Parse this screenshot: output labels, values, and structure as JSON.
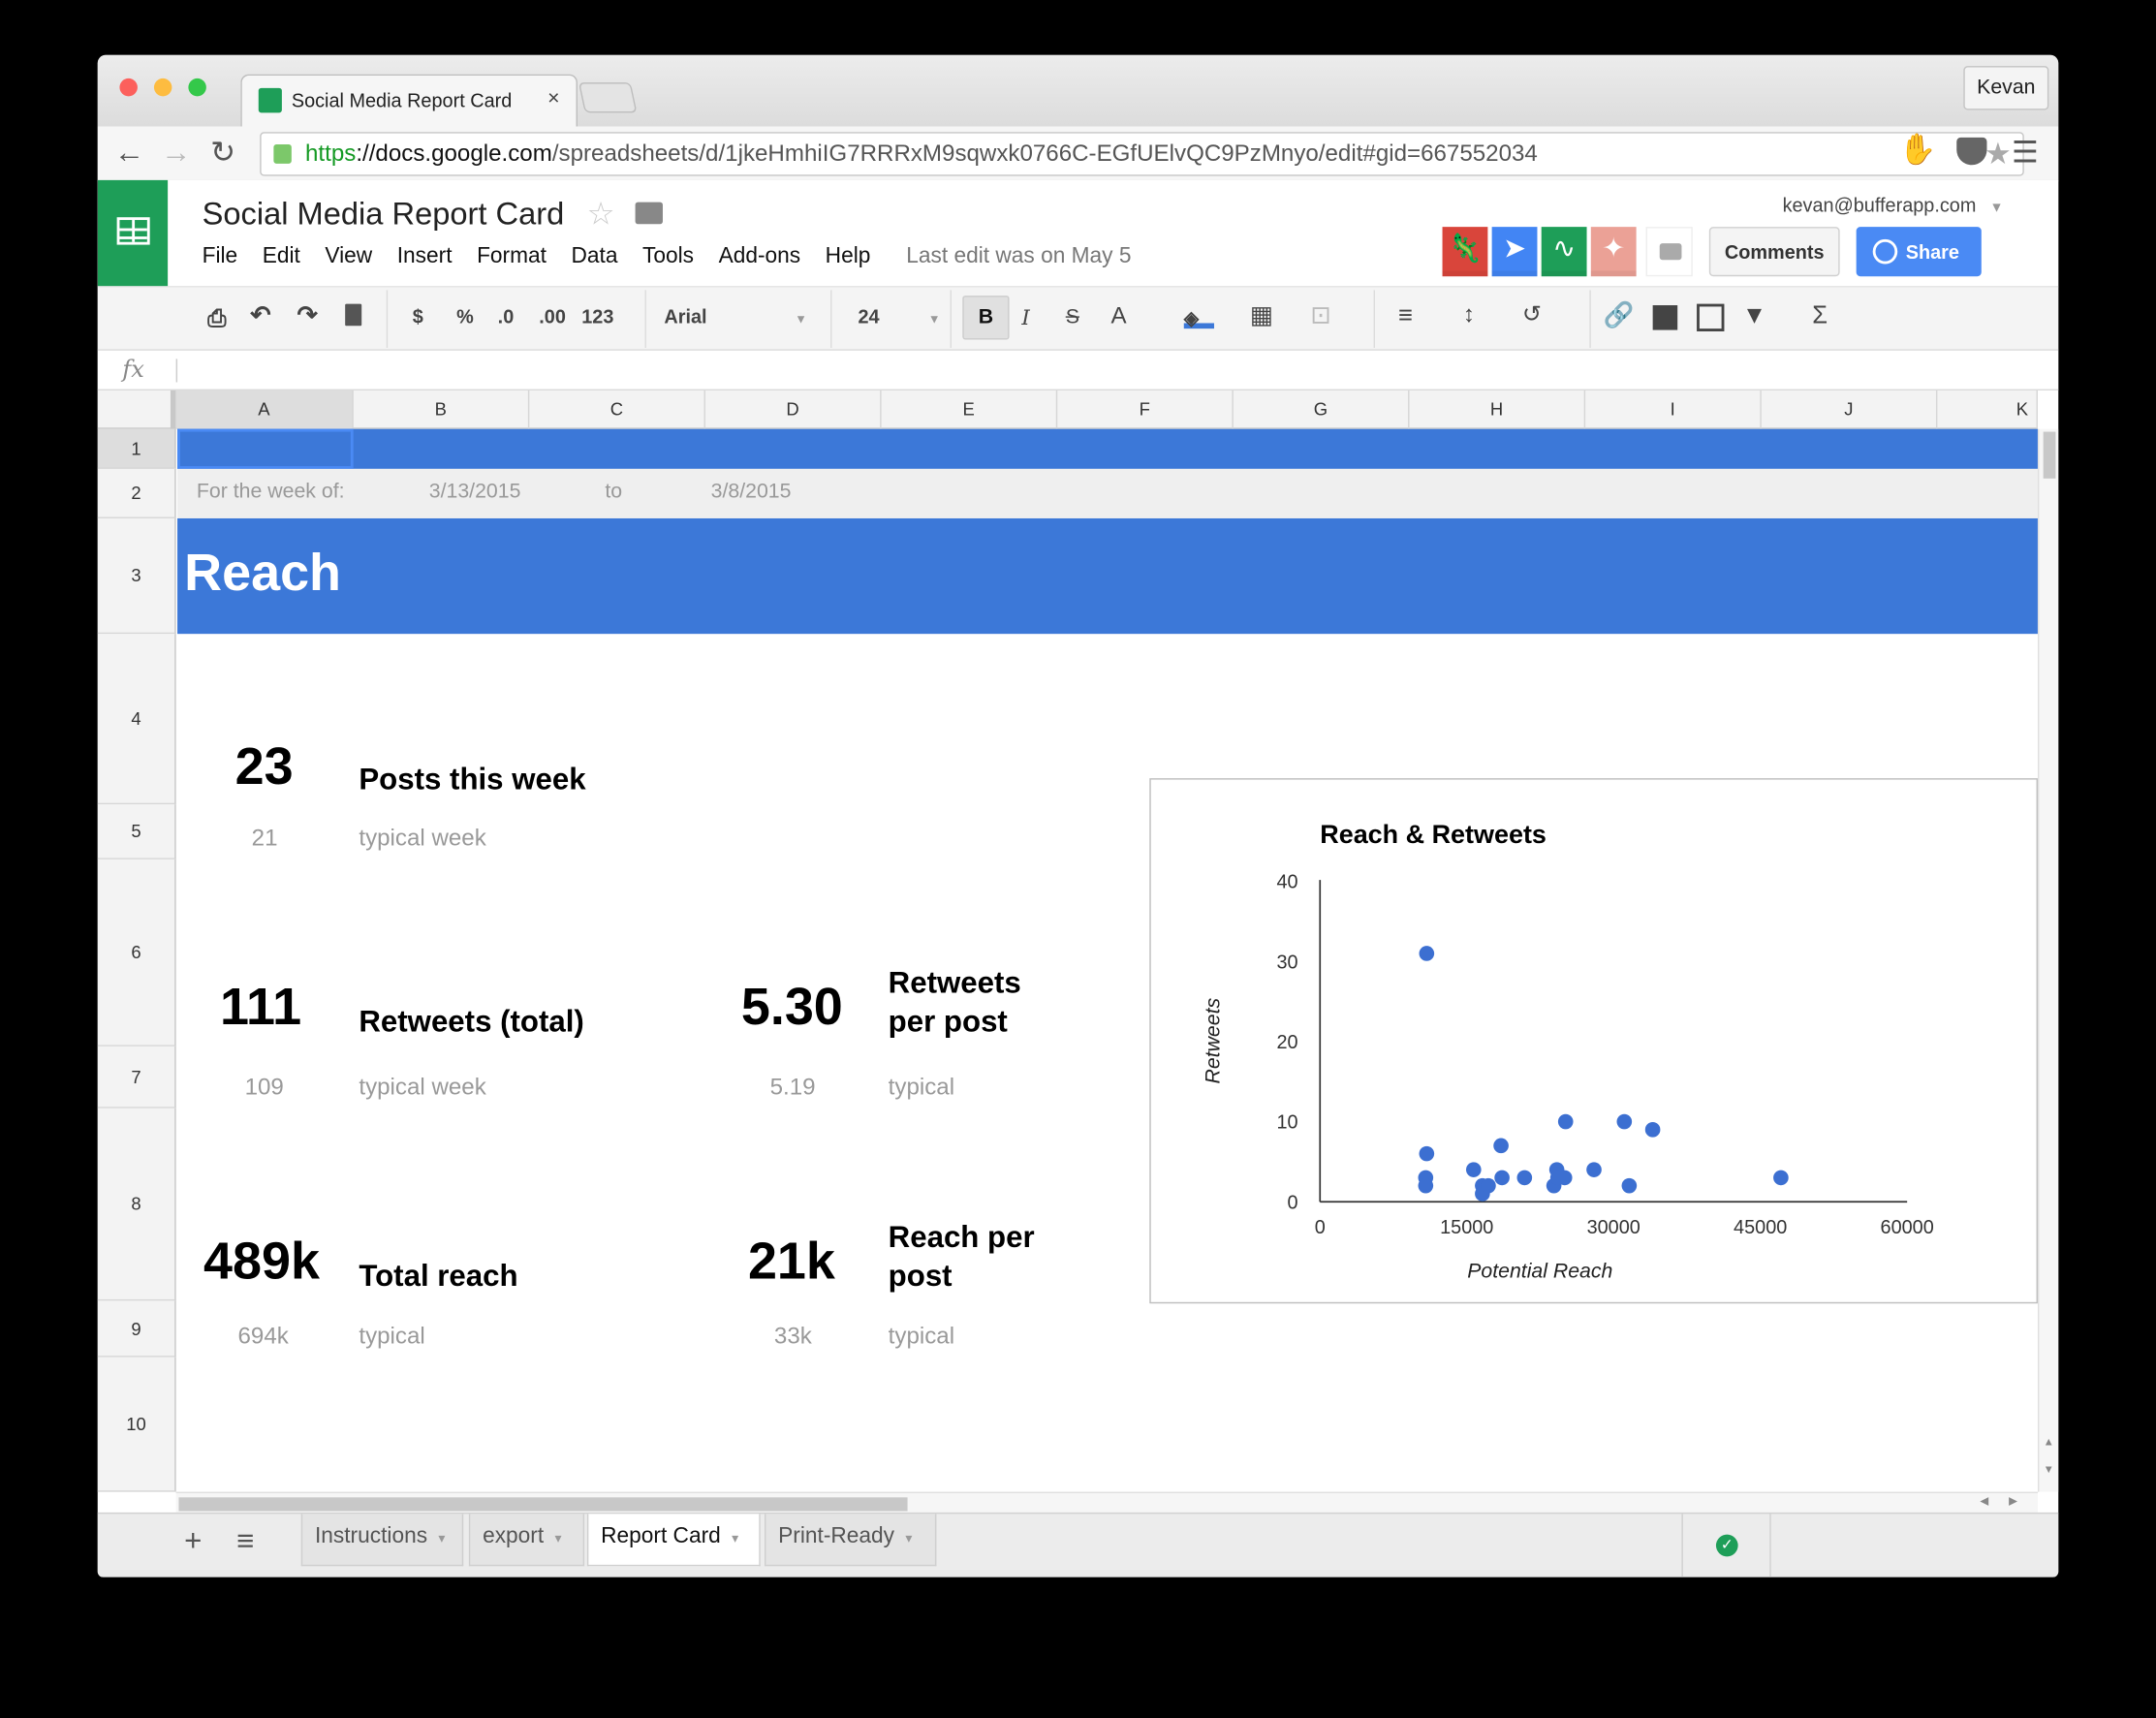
{
  "browser": {
    "tab_title": "Social Media Report Card",
    "tab_close": "×",
    "profile": "Kevan",
    "url_scheme": "https",
    "url_host": "://docs.google.com",
    "url_path": "/spreadsheets/d/1jkeHmhiIG7RRRxM9sqwxk0766C-EGfUElvQC9PzMnyo/edit#gid=667552034",
    "icons": [
      "back-icon",
      "forward-icon",
      "reload-icon",
      "lock-icon",
      "bookmark-star-icon",
      "adblock-icon",
      "pocket-icon",
      "menu-icon"
    ]
  },
  "app": {
    "doc_title": "Social Media Report Card",
    "menu": [
      "File",
      "Edit",
      "View",
      "Insert",
      "Format",
      "Data",
      "Tools",
      "Add-ons",
      "Help"
    ],
    "last_edit": "Last edit was on May 5",
    "user_email": "kevan@bufferapp.com",
    "comments_label": "Comments",
    "share_label": "Share",
    "brand_color": "#1e9e58",
    "share_color": "#4a8af4"
  },
  "toolbar": {
    "currency": "$",
    "percent": "%",
    "dec_decrease": ".0",
    "dec_increase": ".00",
    "more_formats": "123",
    "font": "Arial",
    "font_size": "24",
    "bold": "B",
    "italic": "I",
    "strike": "S",
    "text_color": "A"
  },
  "formula": {
    "fx": "fx",
    "value": ""
  },
  "columns": [
    "A",
    "B",
    "C",
    "D",
    "E",
    "F",
    "G",
    "H",
    "I",
    "J",
    "K"
  ],
  "rows": [
    "1",
    "2",
    "3",
    "4",
    "5",
    "6",
    "7",
    "8",
    "9",
    "10"
  ],
  "sheet": {
    "week_label": "For the week of:",
    "date_from": "3/13/2015",
    "to": "to",
    "date_to": "3/8/2015",
    "section_title": "Reach",
    "header_color": "#3c78d8",
    "metrics": {
      "posts": {
        "value": "23",
        "label": "Posts this week",
        "typical_value": "21",
        "typical_label": "typical week"
      },
      "retweets": {
        "value": "111",
        "label": "Retweets (total)",
        "typical_value": "109",
        "typical_label": "typical week"
      },
      "rt_per_post": {
        "value": "5.30",
        "label_line1": "Retweets",
        "label_line2": "per post",
        "typical_value": "5.19",
        "typical_label": "typical"
      },
      "reach": {
        "value": "489k",
        "label": "Total reach",
        "typical_value": "694k",
        "typical_label": "typical"
      },
      "reach_per_post": {
        "value": "21k",
        "label_line1": "Reach per",
        "label_line2": "post",
        "typical_value": "33k",
        "typical_label": "typical"
      }
    }
  },
  "chart_data": {
    "type": "scatter",
    "title": "Reach & Retweets",
    "xlabel": "Potential Reach",
    "ylabel": "Retweets",
    "xlim": [
      0,
      60000
    ],
    "ylim": [
      0,
      40
    ],
    "xticks": [
      "0",
      "15000",
      "30000",
      "45000",
      "60000"
    ],
    "yticks": [
      "0",
      "10",
      "20",
      "30",
      "40"
    ],
    "grid": false,
    "color": "#3c6fd1",
    "points": [
      {
        "x": 10900,
        "y": 31
      },
      {
        "x": 10900,
        "y": 6
      },
      {
        "x": 10800,
        "y": 3
      },
      {
        "x": 10800,
        "y": 2
      },
      {
        "x": 15700,
        "y": 4
      },
      {
        "x": 16600,
        "y": 2
      },
      {
        "x": 16600,
        "y": 1
      },
      {
        "x": 17200,
        "y": 2
      },
      {
        "x": 18500,
        "y": 7
      },
      {
        "x": 18600,
        "y": 3
      },
      {
        "x": 20900,
        "y": 3
      },
      {
        "x": 23900,
        "y": 2
      },
      {
        "x": 24200,
        "y": 4
      },
      {
        "x": 24300,
        "y": 3
      },
      {
        "x": 25000,
        "y": 3
      },
      {
        "x": 25100,
        "y": 10
      },
      {
        "x": 28000,
        "y": 4
      },
      {
        "x": 31100,
        "y": 10
      },
      {
        "x": 31600,
        "y": 2
      },
      {
        "x": 34000,
        "y": 9
      },
      {
        "x": 47100,
        "y": 3
      }
    ]
  },
  "sheet_tabs": [
    {
      "label": "Instructions",
      "active": false
    },
    {
      "label": "export",
      "active": false
    },
    {
      "label": "Report Card",
      "active": true
    },
    {
      "label": "Print-Ready",
      "active": false
    }
  ],
  "sheet_bar": {
    "add": "+",
    "list": "≡",
    "dropdown": "▾"
  }
}
